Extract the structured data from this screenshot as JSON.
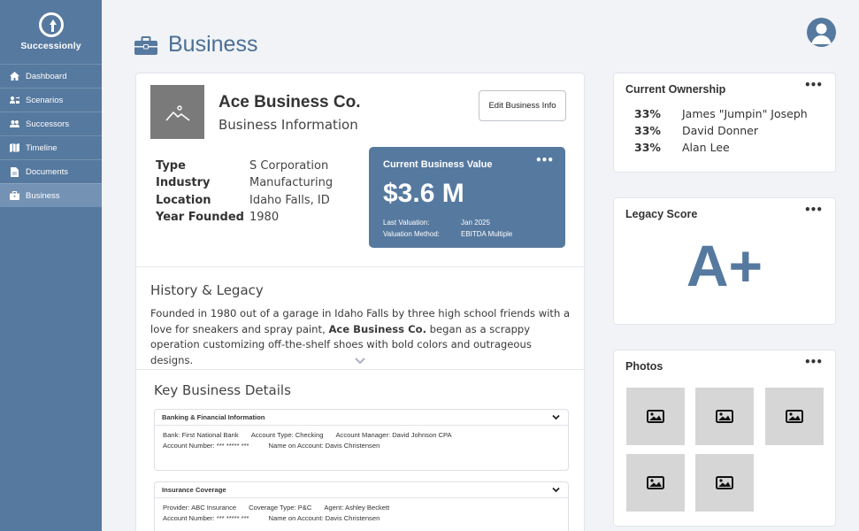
{
  "app": {
    "name": "Successionly"
  },
  "sidebar": {
    "items": [
      {
        "label": "Dashboard",
        "icon": "home-icon"
      },
      {
        "label": "Scenarios",
        "icon": "people-arrow-icon"
      },
      {
        "label": "Successors",
        "icon": "users-icon"
      },
      {
        "label": "Timeline",
        "icon": "map-icon"
      },
      {
        "label": "Documents",
        "icon": "document-icon"
      },
      {
        "label": "Business",
        "icon": "briefcase-icon",
        "active": true
      }
    ]
  },
  "header": {
    "title": "Business"
  },
  "business": {
    "name": "Ace Business Co.",
    "subtitle": "Business Information",
    "edit_label": "Edit Business Info",
    "facts": [
      {
        "key": "Type",
        "value": "S Corporation"
      },
      {
        "key": "Industry",
        "value": "Manufacturing"
      },
      {
        "key": "Location",
        "value": "Idaho Falls, ID"
      },
      {
        "key": "Year Founded",
        "value": "1980"
      }
    ]
  },
  "value_card": {
    "title": "Current Business Value",
    "menu": "•••",
    "amount": "$3.6 M",
    "last_valuation_label": "Last Valuation:",
    "last_valuation_value": "Jan 2025",
    "method_label": "Valuation Method:",
    "method_value": "EBITDA Multiple"
  },
  "history": {
    "title": "History & Legacy",
    "text_before": "Founded in 1980 out of a garage in Idaho Falls by three high school friends with a love for sneakers and spray paint, ",
    "text_bold": "Ace Business Co.",
    "text_after": " began as a scrappy operation customizing off-the-shelf shoes with bold colors and outrageous designs."
  },
  "key_details": {
    "title": "Key Business Details",
    "sections": [
      {
        "title": "Banking & Financial Information",
        "line1": [
          "Bank: First National Bank",
          "Account Type: Checking",
          "Account Manager: David Johnson CPA"
        ],
        "line2": [
          "Account Number: *** ***** ***",
          "Name on Account: Davis Christensen"
        ]
      },
      {
        "title": "Insurance Coverage",
        "line1": [
          "Provider: ABC Insurance",
          "Coverage Type: P&C",
          "Agent: Ashley Beckett"
        ],
        "line2": [
          "Account Number: *** ***** ***",
          "Name on Account: Davis Christensen"
        ]
      }
    ]
  },
  "ownership": {
    "title": "Current Ownership",
    "menu": "•••",
    "owners": [
      {
        "pct": "33%",
        "name": "James \"Jumpin\" Joseph"
      },
      {
        "pct": "33%",
        "name": "David Donner"
      },
      {
        "pct": "33%",
        "name": "Alan Lee"
      }
    ]
  },
  "legacy": {
    "title": "Legacy Score",
    "menu": "•••",
    "grade": "A+"
  },
  "photos": {
    "title": "Photos",
    "menu": "•••",
    "count": 5
  },
  "colors": {
    "sidebar": "#56799f",
    "accent": "#4b6f96",
    "active_nav": "#7392b4",
    "photo_bg": "#d6d6d6"
  }
}
